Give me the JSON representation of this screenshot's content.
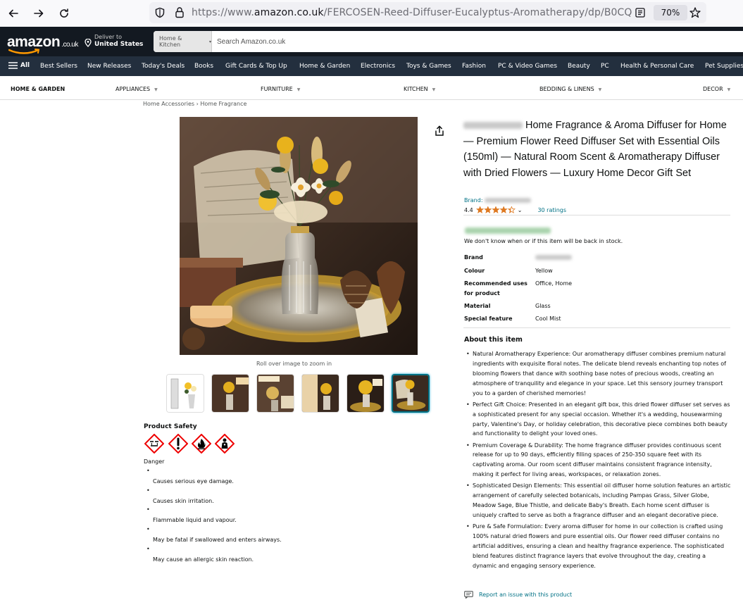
{
  "browser": {
    "url_prefix": "https://www.",
    "url_host": "amazon.co.uk",
    "url_path": "/FERCOSEN-Reed-Diffuser-Eucalyptus-Aromatherapy/dp/B0CQ",
    "zoom": "70%"
  },
  "header": {
    "logo": "amazon",
    "logo_tld": ".co.uk",
    "deliver_label": "Deliver to",
    "deliver_location": "United States",
    "search_category": "Home & Kitchen",
    "search_placeholder": "Search Amazon.co.uk"
  },
  "nav": {
    "all_label": "All",
    "items": [
      "Best Sellers",
      "New Releases",
      "Today's Deals",
      "Books",
      "Gift Cards & Top Up",
      "Home & Garden",
      "Electronics",
      "Toys & Games",
      "Fashion",
      "PC & Video Games",
      "Beauty",
      "PC",
      "Health & Personal Care",
      "Pet Supplies"
    ]
  },
  "subnav": {
    "items": [
      "HOME & GARDEN",
      "APPLIANCES",
      "FURNITURE",
      "KITCHEN",
      "BEDDING & LINENS",
      "DECOR"
    ]
  },
  "breadcrumb": {
    "first": "Home Accessories",
    "separator": "›",
    "second": "Home Fragrance"
  },
  "gallery": {
    "zoom_hint": "Roll over image to zoom in",
    "thumb_count": 6,
    "active_thumb": 6
  },
  "safety": {
    "title": "Product Safety",
    "signal_word": "Danger",
    "hazards": [
      "Causes serious eye damage.",
      "Causes skin irritation.",
      "Flammable liquid and vapour.",
      "May be fatal if swallowed and enters airways.",
      "May cause an allergic skin reaction."
    ]
  },
  "product": {
    "title": "Home Fragrance & Aroma Diffuser for Home — Premium Flower Reed Diffuser Set with Essential Oils (150ml) — Natural Room Scent & Aromatherapy Diffuser with Dried Flowers — Luxury Home Decor Gift Set",
    "brand_label": "Brand:",
    "rating_value": "4.4",
    "rating_fraction": 0.88,
    "ratings_count": "30 ratings",
    "stock_message": "We don't know when or if this item will be back in stock.",
    "specs": [
      {
        "key": "Brand",
        "value": ""
      },
      {
        "key": "Colour",
        "value": "Yellow"
      },
      {
        "key": "Recommended uses for product",
        "value": "Office, Home"
      },
      {
        "key": "Material",
        "value": "Glass"
      },
      {
        "key": "Special feature",
        "value": "Cool Mist"
      }
    ],
    "about_title": "About this item",
    "about": [
      "Natural Aromatherapy Experience: Our aromatherapy diffuser combines premium natural ingredients with exquisite floral notes. The delicate blend reveals enchanting top notes of blooming flowers that dance with soothing base notes of precious woods, creating an atmosphere of tranquility and elegance in your space. Let this sensory journey transport you to a garden of cherished memories!",
      "Perfect Gift Choice: Presented in an elegant gift box, this dried flower diffuser set serves as a sophisticated present for any special occasion. Whether it's a wedding, housewarming party, Valentine's Day, or holiday celebration, this decorative piece combines both beauty and functionality to delight your loved ones.",
      "Premium Coverage & Durability: The home fragrance diffuser provides continuous scent release for up to 90 days, efficiently filling spaces of 250-350 square feet with its captivating aroma. Our room scent diffuser maintains consistent fragrance intensity, making it perfect for living areas, workspaces, or relaxation zones.",
      "Sophisticated Design Elements: This essential oil diffuser home solution features an artistic arrangement of carefully selected botanicals, including Pampas Grass, Silver Globe, Meadow Sage, Blue Thistle, and delicate Baby's Breath. Each home scent diffuser is uniquely crafted to serve as both a fragrance diffuser and an elegant decorative piece.",
      "Pure & Safe Formulation: Every aroma diffuser for home in our collection is crafted using 100% natural dried flowers and pure essential oils. Our flower reed diffuser contains no artificial additives, ensuring a clean and healthy fragrance experience. The sophisticated blend features distinct fragrance layers that evolve throughout the day, creating a dynamic and engaging sensory experience."
    ],
    "report_link": "Report an issue with this product"
  }
}
